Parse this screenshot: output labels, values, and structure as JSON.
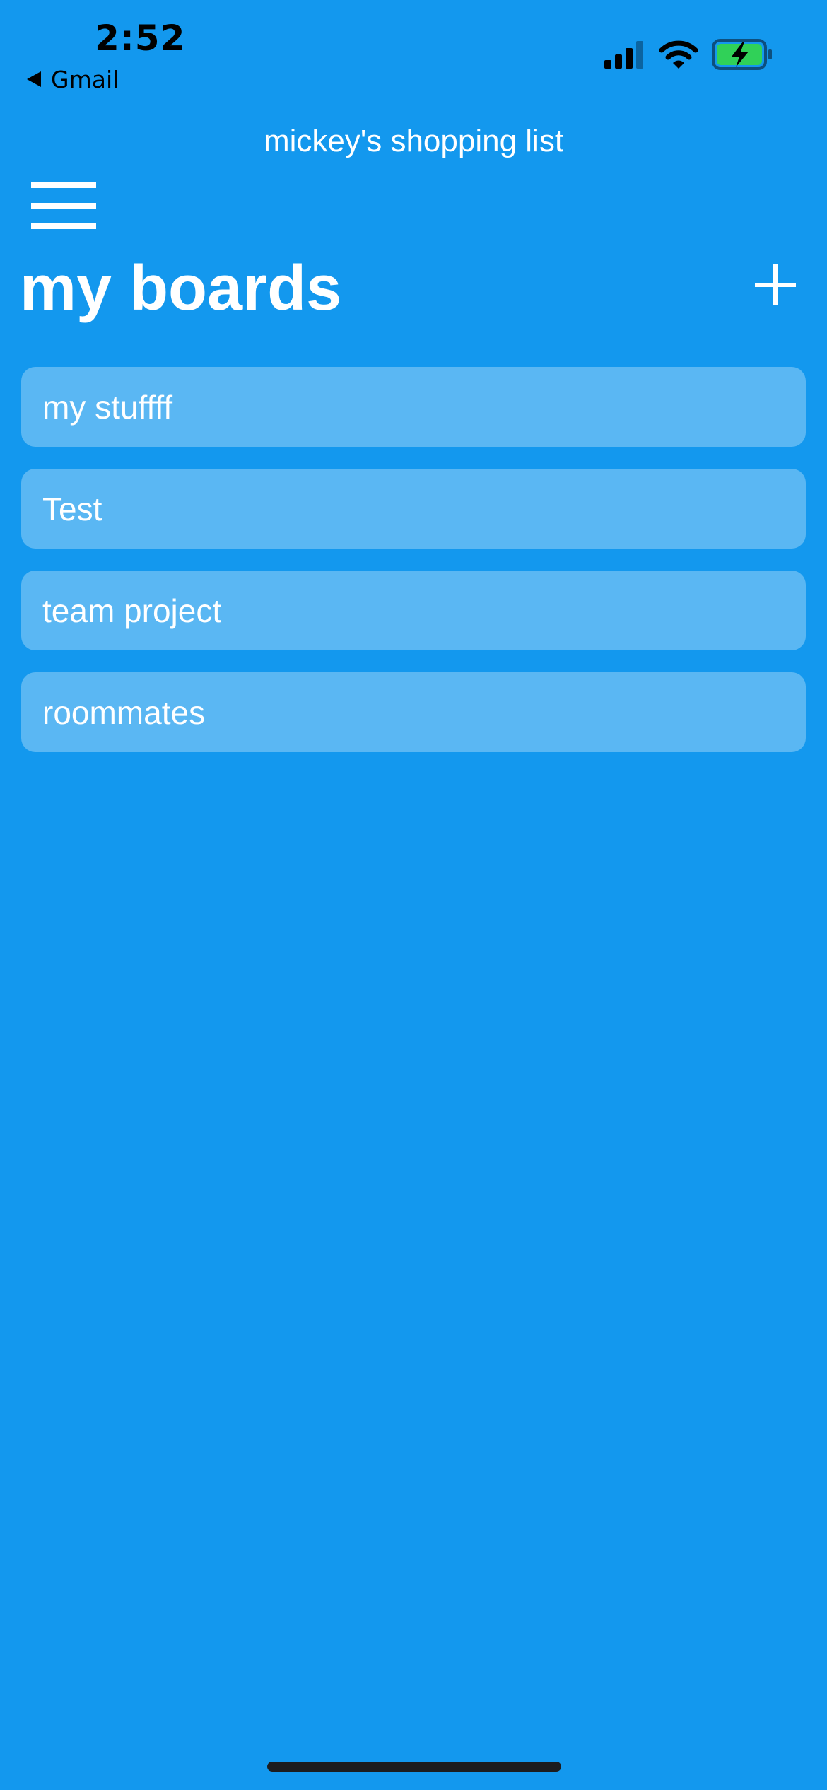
{
  "status_bar": {
    "time": "2:52",
    "back_app": "Gmail",
    "icons": [
      "cellular-signal-icon",
      "wifi-icon",
      "battery-charging-icon"
    ],
    "battery_color": "#30d158"
  },
  "header": {
    "app_title": "mickey's shopping list",
    "menu_icon": "hamburger-menu-icon",
    "add_icon": "plus-icon"
  },
  "main": {
    "page_title": "my boards",
    "boards": [
      {
        "label": "my stuffff"
      },
      {
        "label": "Test"
      },
      {
        "label": "team project"
      },
      {
        "label": "roommates"
      }
    ]
  },
  "colors": {
    "background": "#1398ee",
    "card": "rgba(255,255,255,0.30)",
    "text": "#ffffff"
  }
}
